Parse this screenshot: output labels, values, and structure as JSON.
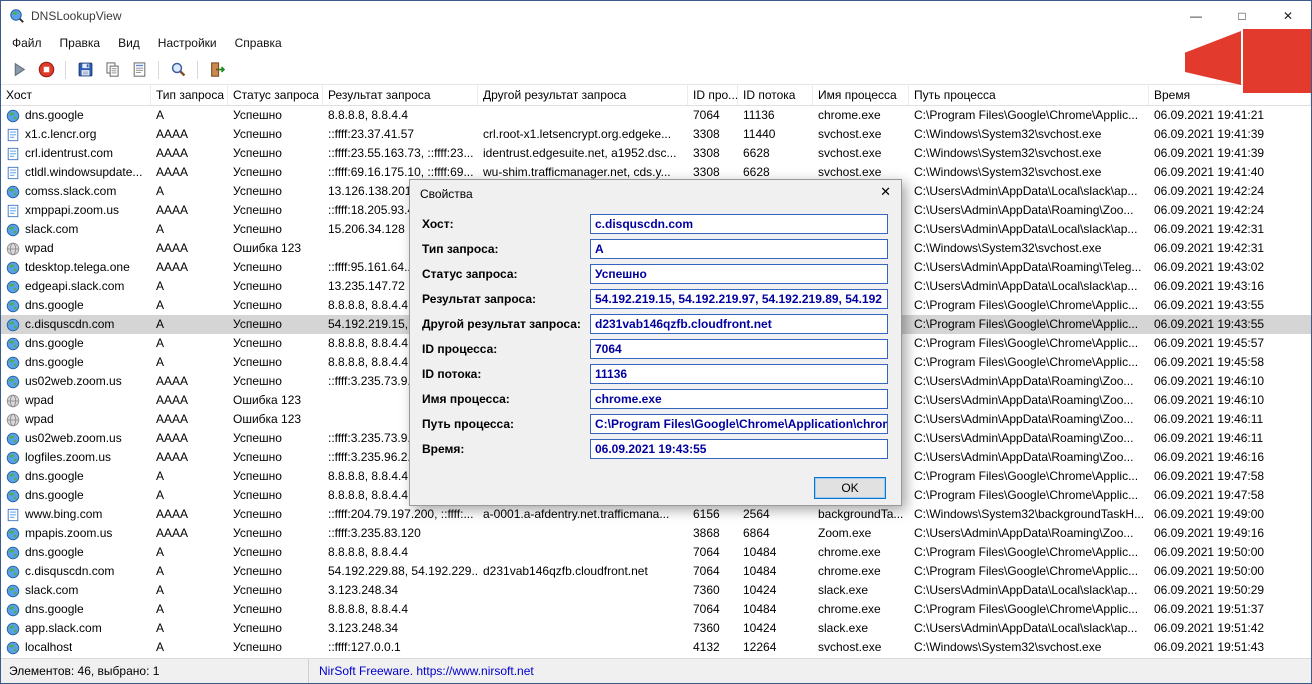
{
  "window": {
    "title": "DNSLookupView"
  },
  "titlebar": {
    "minimize_glyph": "—",
    "maximize_glyph": "□",
    "close_glyph": "✕"
  },
  "menu": {
    "items": [
      {
        "key": "file",
        "label": "Файл"
      },
      {
        "key": "edit",
        "label": "Правка"
      },
      {
        "key": "view",
        "label": "Вид"
      },
      {
        "key": "options",
        "label": "Настройки"
      },
      {
        "key": "help",
        "label": "Справка"
      }
    ]
  },
  "toolbar": {
    "buttons": [
      {
        "key": "run"
      },
      {
        "key": "stop"
      },
      {
        "key": "sep"
      },
      {
        "key": "save"
      },
      {
        "key": "copy"
      },
      {
        "key": "properties"
      },
      {
        "key": "sep"
      },
      {
        "key": "find"
      },
      {
        "key": "sep"
      },
      {
        "key": "exit"
      }
    ]
  },
  "table": {
    "columns": [
      {
        "key": "host",
        "label": "Хост"
      },
      {
        "key": "type",
        "label": "Тип запроса"
      },
      {
        "key": "status",
        "label": "Статус запроса"
      },
      {
        "key": "result",
        "label": "Результат запроса"
      },
      {
        "key": "other-result",
        "label": "Другой результат запроса"
      },
      {
        "key": "process-id",
        "label": "ID про..."
      },
      {
        "key": "thread-id",
        "label": "ID потока"
      },
      {
        "key": "process-name",
        "label": "Имя процесса"
      },
      {
        "key": "process-path",
        "label": "Путь процесса"
      },
      {
        "key": "time",
        "label": "Время"
      }
    ],
    "rows": [
      {
        "icon": "globe",
        "host": "dns.google",
        "type": "A",
        "status": "Успешно",
        "result": "8.8.8.8, 8.8.4.4",
        "other": "",
        "pid": "7064",
        "tid": "11136",
        "pname": "chrome.exe",
        "path": "C:\\Program Files\\Google\\Chrome\\Applic...",
        "time": "06.09.2021 19:41:21"
      },
      {
        "icon": "page",
        "host": "x1.c.lencr.org",
        "type": "AAAA",
        "status": "Успешно",
        "result": "::ffff:23.37.41.57",
        "other": "crl.root-x1.letsencrypt.org.edgeke...",
        "pid": "3308",
        "tid": "11440",
        "pname": "svchost.exe",
        "path": "C:\\Windows\\System32\\svchost.exe",
        "time": "06.09.2021 19:41:39"
      },
      {
        "icon": "page",
        "host": "crl.identrust.com",
        "type": "AAAA",
        "status": "Успешно",
        "result": "::ffff:23.55.163.73, ::ffff:23...",
        "other": "identrust.edgesuite.net, a1952.dsc...",
        "pid": "3308",
        "tid": "6628",
        "pname": "svchost.exe",
        "path": "C:\\Windows\\System32\\svchost.exe",
        "time": "06.09.2021 19:41:39"
      },
      {
        "icon": "page",
        "host": "ctldl.windowsupdate...",
        "type": "AAAA",
        "status": "Успешно",
        "result": "::ffff:69.16.175.10, ::ffff:69...",
        "other": "wu-shim.trafficmanager.net, cds.y...",
        "pid": "3308",
        "tid": "6628",
        "pname": "svchost.exe",
        "path": "C:\\Windows\\System32\\svchost.exe",
        "time": "06.09.2021 19:41:40"
      },
      {
        "icon": "globe",
        "host": "comss.slack.com",
        "type": "A",
        "status": "Успешно",
        "result": "13.126.138.201...",
        "other": "",
        "pid": "",
        "tid": "",
        "pname": "",
        "path": "C:\\Users\\Admin\\AppData\\Local\\slack\\ap...",
        "time": "06.09.2021 19:42:24"
      },
      {
        "icon": "page",
        "host": "xmppapi.zoom.us",
        "type": "AAAA",
        "status": "Успешно",
        "result": "::ffff:18.205.93.4...",
        "other": "",
        "pid": "",
        "tid": "",
        "pname": "",
        "path": "C:\\Users\\Admin\\AppData\\Roaming\\Zoo...",
        "time": "06.09.2021 19:42:24"
      },
      {
        "icon": "globe",
        "host": "slack.com",
        "type": "A",
        "status": "Успешно",
        "result": "15.206.34.128",
        "other": "",
        "pid": "",
        "tid": "",
        "pname": "",
        "path": "C:\\Users\\Admin\\AppData\\Local\\slack\\ap...",
        "time": "06.09.2021 19:42:31"
      },
      {
        "icon": "wpad",
        "host": "wpad",
        "type": "AAAA",
        "status": "Ошибка 123",
        "result": "",
        "other": "",
        "pid": "",
        "tid": "",
        "pname": "",
        "path": "C:\\Windows\\System32\\svchost.exe",
        "time": "06.09.2021 19:42:31"
      },
      {
        "icon": "globe",
        "host": "tdesktop.telega.one",
        "type": "AAAA",
        "status": "Успешно",
        "result": "::ffff:95.161.64...",
        "other": "",
        "pid": "",
        "tid": "",
        "pname": "",
        "path": "C:\\Users\\Admin\\AppData\\Roaming\\Teleg...",
        "time": "06.09.2021 19:43:02"
      },
      {
        "icon": "globe",
        "host": "edgeapi.slack.com",
        "type": "A",
        "status": "Успешно",
        "result": "13.235.147.72",
        "other": "",
        "pid": "",
        "tid": "",
        "pname": "",
        "path": "C:\\Users\\Admin\\AppData\\Local\\slack\\ap...",
        "time": "06.09.2021 19:43:16"
      },
      {
        "icon": "globe",
        "host": "dns.google",
        "type": "A",
        "status": "Успешно",
        "result": "8.8.8.8, 8.8.4.4",
        "other": "",
        "pid": "",
        "tid": "",
        "pname": "",
        "path": "C:\\Program Files\\Google\\Chrome\\Applic...",
        "time": "06.09.2021 19:43:55"
      },
      {
        "icon": "globe",
        "host": "c.disquscdn.com",
        "type": "A",
        "status": "Успешно",
        "result": "54.192.219.15, 54.192.219.97, 54.192.219.89, 54.192...",
        "other": "",
        "pid": "",
        "tid": "",
        "pname": "",
        "path": "C:\\Program Files\\Google\\Chrome\\Applic...",
        "time": "06.09.2021 19:43:55",
        "selected": true
      },
      {
        "icon": "globe",
        "host": "dns.google",
        "type": "A",
        "status": "Успешно",
        "result": "8.8.8.8, 8.8.4.4",
        "other": "",
        "pid": "",
        "tid": "",
        "pname": "",
        "path": "C:\\Program Files\\Google\\Chrome\\Applic...",
        "time": "06.09.2021 19:45:57"
      },
      {
        "icon": "globe",
        "host": "dns.google",
        "type": "A",
        "status": "Успешно",
        "result": "8.8.8.8, 8.8.4.4",
        "other": "",
        "pid": "",
        "tid": "",
        "pname": "",
        "path": "C:\\Program Files\\Google\\Chrome\\Applic...",
        "time": "06.09.2021 19:45:58"
      },
      {
        "icon": "globe",
        "host": "us02web.zoom.us",
        "type": "AAAA",
        "status": "Успешно",
        "result": "::ffff:3.235.73.9...",
        "other": "",
        "pid": "",
        "tid": "",
        "pname": "",
        "path": "C:\\Users\\Admin\\AppData\\Roaming\\Zoo...",
        "time": "06.09.2021 19:46:10"
      },
      {
        "icon": "wpad",
        "host": "wpad",
        "type": "AAAA",
        "status": "Ошибка 123",
        "result": "",
        "other": "",
        "pid": "",
        "tid": "",
        "pname": "",
        "path": "C:\\Users\\Admin\\AppData\\Roaming\\Zoo...",
        "time": "06.09.2021 19:46:10"
      },
      {
        "icon": "wpad",
        "host": "wpad",
        "type": "AAAA",
        "status": "Ошибка 123",
        "result": "",
        "other": "",
        "pid": "",
        "tid": "",
        "pname": "",
        "path": "C:\\Users\\Admin\\AppData\\Roaming\\Zoo...",
        "time": "06.09.2021 19:46:11"
      },
      {
        "icon": "globe",
        "host": "us02web.zoom.us",
        "type": "AAAA",
        "status": "Успешно",
        "result": "::ffff:3.235.73.9...",
        "other": "",
        "pid": "",
        "tid": "",
        "pname": "",
        "path": "C:\\Users\\Admin\\AppData\\Roaming\\Zoo...",
        "time": "06.09.2021 19:46:11"
      },
      {
        "icon": "globe",
        "host": "logfiles.zoom.us",
        "type": "AAAA",
        "status": "Успешно",
        "result": "::ffff:3.235.96.2...",
        "other": "",
        "pid": "",
        "tid": "",
        "pname": "",
        "path": "C:\\Users\\Admin\\AppData\\Roaming\\Zoo...",
        "time": "06.09.2021 19:46:16"
      },
      {
        "icon": "globe",
        "host": "dns.google",
        "type": "A",
        "status": "Успешно",
        "result": "8.8.8.8, 8.8.4.4",
        "other": "",
        "pid": "",
        "tid": "",
        "pname": "",
        "path": "C:\\Program Files\\Google\\Chrome\\Applic...",
        "time": "06.09.2021 19:47:58"
      },
      {
        "icon": "globe",
        "host": "dns.google",
        "type": "A",
        "status": "Успешно",
        "result": "8.8.8.8, 8.8.4.4",
        "other": "",
        "pid": "",
        "tid": "",
        "pname": "",
        "path": "C:\\Program Files\\Google\\Chrome\\Applic...",
        "time": "06.09.2021 19:47:58"
      },
      {
        "icon": "page",
        "host": "www.bing.com",
        "type": "AAAA",
        "status": "Успешно",
        "result": "::ffff:204.79.197.200, ::ffff:...",
        "other": "a-0001.a-afdentry.net.trafficmana...",
        "pid": "6156",
        "tid": "2564",
        "pname": "backgroundTa...",
        "path": "C:\\Windows\\System32\\backgroundTaskH...",
        "time": "06.09.2021 19:49:00"
      },
      {
        "icon": "globe",
        "host": "mpapis.zoom.us",
        "type": "AAAA",
        "status": "Успешно",
        "result": "::ffff:3.235.83.120",
        "other": "",
        "pid": "3868",
        "tid": "6864",
        "pname": "Zoom.exe",
        "path": "C:\\Users\\Admin\\AppData\\Roaming\\Zoo...",
        "time": "06.09.2021 19:49:16"
      },
      {
        "icon": "globe",
        "host": "dns.google",
        "type": "A",
        "status": "Успешно",
        "result": "8.8.8.8, 8.8.4.4",
        "other": "",
        "pid": "7064",
        "tid": "10484",
        "pname": "chrome.exe",
        "path": "C:\\Program Files\\Google\\Chrome\\Applic...",
        "time": "06.09.2021 19:50:00"
      },
      {
        "icon": "globe",
        "host": "c.disquscdn.com",
        "type": "A",
        "status": "Успешно",
        "result": "54.192.229.88, 54.192.229...",
        "other": "d231vab146qzfb.cloudfront.net",
        "pid": "7064",
        "tid": "10484",
        "pname": "chrome.exe",
        "path": "C:\\Program Files\\Google\\Chrome\\Applic...",
        "time": "06.09.2021 19:50:00"
      },
      {
        "icon": "globe",
        "host": "slack.com",
        "type": "A",
        "status": "Успешно",
        "result": "3.123.248.34",
        "other": "",
        "pid": "7360",
        "tid": "10424",
        "pname": "slack.exe",
        "path": "C:\\Users\\Admin\\AppData\\Local\\slack\\ap...",
        "time": "06.09.2021 19:50:29"
      },
      {
        "icon": "globe",
        "host": "dns.google",
        "type": "A",
        "status": "Успешно",
        "result": "8.8.8.8, 8.8.4.4",
        "other": "",
        "pid": "7064",
        "tid": "10484",
        "pname": "chrome.exe",
        "path": "C:\\Program Files\\Google\\Chrome\\Applic...",
        "time": "06.09.2021 19:51:37"
      },
      {
        "icon": "globe",
        "host": "app.slack.com",
        "type": "A",
        "status": "Успешно",
        "result": "3.123.248.34",
        "other": "",
        "pid": "7360",
        "tid": "10424",
        "pname": "slack.exe",
        "path": "C:\\Users\\Admin\\AppData\\Local\\slack\\ap...",
        "time": "06.09.2021 19:51:42"
      },
      {
        "icon": "globe",
        "host": "localhost",
        "type": "A",
        "status": "Успешно",
        "result": "::ffff:127.0.0.1",
        "other": "",
        "pid": "4132",
        "tid": "12264",
        "pname": "svchost.exe",
        "path": "C:\\Windows\\System32\\svchost.exe",
        "time": "06.09.2021 19:51:43"
      }
    ]
  },
  "dialog": {
    "title": "Свойства",
    "close_glyph": "✕",
    "ok_label": "OK",
    "fields": [
      {
        "key": "host",
        "label": "Хост:",
        "value": "c.disquscdn.com"
      },
      {
        "key": "query-type",
        "label": "Тип запроса:",
        "value": "A"
      },
      {
        "key": "query-status",
        "label": "Статус запроса:",
        "value": "Успешно"
      },
      {
        "key": "query-result",
        "label": "Результат запроса:",
        "value": "54.192.219.15, 54.192.219.97, 54.192.219.89, 54.192"
      },
      {
        "key": "other-result",
        "label": "Другой результат запроса:",
        "value": "d231vab146qzfb.cloudfront.net"
      },
      {
        "key": "process-id",
        "label": "ID процесса:",
        "value": "7064"
      },
      {
        "key": "thread-id",
        "label": "ID потока:",
        "value": "11136"
      },
      {
        "key": "process-name",
        "label": "Имя процесса:",
        "value": "chrome.exe"
      },
      {
        "key": "process-path",
        "label": "Путь процесса:",
        "value": "C:\\Program Files\\Google\\Chrome\\Application\\chrom"
      },
      {
        "key": "time",
        "label": "Время:",
        "value": "06.09.2021 19:43:55"
      }
    ]
  },
  "statusbar": {
    "left": "Элементов: 46, выбрано: 1",
    "link": "NirSoft Freeware. https://www.nirsoft.net"
  },
  "colors": {
    "watermark_red": "#e23b2d",
    "link_blue": "#0000cd",
    "dialog_value_navy": "#0000a0",
    "selection_gray": "#d5d5d5"
  }
}
